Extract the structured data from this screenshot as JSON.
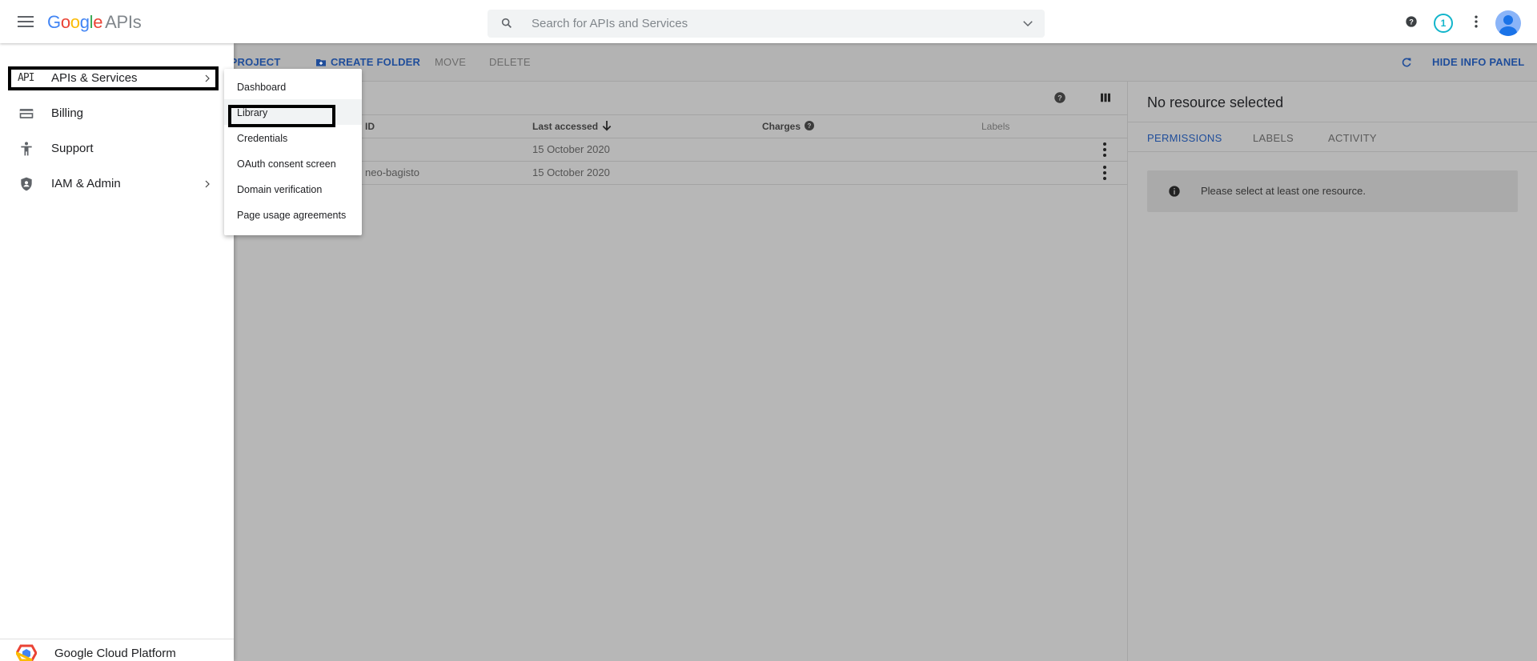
{
  "header": {
    "logo": {
      "G": "G",
      "o1": "o",
      "o2": "o",
      "g": "g",
      "l": "l",
      "e": "e",
      "apis": "APIs"
    },
    "search_placeholder": "Search for APIs and Services",
    "notification_count": "1"
  },
  "toolbar": {
    "create_project": "E PROJECT",
    "create_folder": "CREATE FOLDER",
    "move": "MOVE",
    "delete": "DELETE",
    "hide_info_panel": "HIDE INFO PANEL"
  },
  "table": {
    "columns": {
      "id": "ID",
      "last_accessed": "Last accessed",
      "charges": "Charges",
      "labels": "Labels"
    },
    "rows": [
      {
        "id": "",
        "last_accessed": "15 October 2020"
      },
      {
        "id": "neo-bagisto",
        "last_accessed": "15 October 2020"
      }
    ]
  },
  "info_panel": {
    "title": "No resource selected",
    "tabs": [
      "PERMISSIONS",
      "LABELS",
      "ACTIVITY"
    ],
    "message": "Please select at least one resource."
  },
  "sidebar": {
    "items": [
      {
        "label": "APIs & Services",
        "icon": "api-icon",
        "glyph": "API"
      },
      {
        "label": "Billing",
        "icon": "billing-icon"
      },
      {
        "label": "Support",
        "icon": "support-icon"
      },
      {
        "label": "IAM & Admin",
        "icon": "shield-icon"
      }
    ],
    "footer": "Google Cloud Platform"
  },
  "submenu": {
    "items": [
      "Dashboard",
      "Library",
      "Credentials",
      "OAuth consent screen",
      "Domain verification",
      "Page usage agreements"
    ]
  },
  "colors": {
    "accent": "#1a73e8",
    "link": "#1f4d9a",
    "notif": "#12b5cb"
  }
}
